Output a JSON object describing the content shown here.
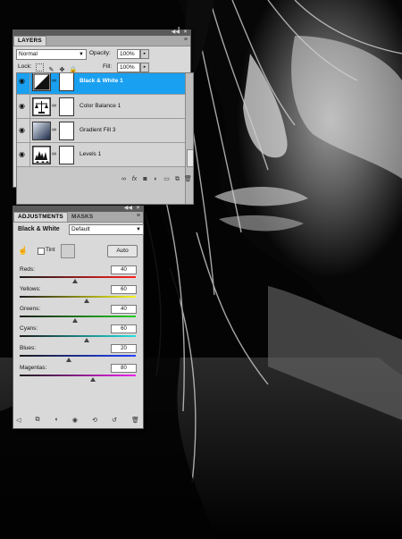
{
  "layers_panel": {
    "tab_label": "LAYERS",
    "blend_mode": "Normal",
    "opacity_label": "Opacity:",
    "opacity_value": "100%",
    "lock_label": "Lock:",
    "fill_label": "Fill:",
    "fill_value": "100%",
    "layers": [
      {
        "name": "Black & White 1",
        "selected": true,
        "icon": "black-white-adjustment-icon"
      },
      {
        "name": "Color Balance 1",
        "selected": false,
        "icon": "color-balance-adjustment-icon"
      },
      {
        "name": "Gradient Fill 3",
        "selected": false,
        "icon": "gradient-fill-icon"
      },
      {
        "name": "Levels 1",
        "selected": false,
        "icon": "levels-adjustment-icon"
      }
    ],
    "selected_color": "#1aa0f0"
  },
  "adjustments_panel": {
    "tabs": [
      "ADJUSTMENTS",
      "MASKS"
    ],
    "title": "Black & White",
    "preset": "Default",
    "tint_label": "Tint",
    "auto_label": "Auto",
    "sliders": [
      {
        "label": "Reds:",
        "value": "40",
        "position": 0.48
      },
      {
        "label": "Yellows:",
        "value": "60",
        "position": 0.58
      },
      {
        "label": "Greens:",
        "value": "40",
        "position": 0.48
      },
      {
        "label": "Cyans:",
        "value": "60",
        "position": 0.58
      },
      {
        "label": "Blues:",
        "value": "20",
        "position": 0.42
      },
      {
        "label": "Magentas:",
        "value": "80",
        "position": 0.63
      }
    ]
  }
}
